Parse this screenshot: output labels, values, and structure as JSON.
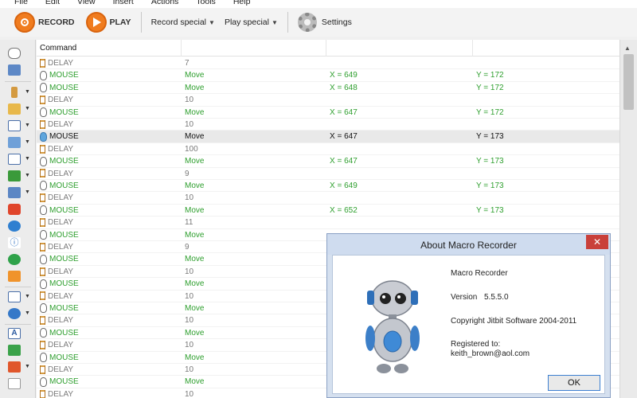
{
  "menubar": {
    "items": [
      "File",
      "Edit",
      "View",
      "Insert",
      "Actions",
      "Tools",
      "Help"
    ]
  },
  "toolbar": {
    "record_label": "RECORD",
    "play_label": "PLAY",
    "record_special_label": "Record special",
    "play_special_label": "Play special",
    "settings_label": "Settings"
  },
  "grid": {
    "columns": [
      "Command",
      "",
      "",
      ""
    ],
    "rows": [
      {
        "type": "delay",
        "cmd": "DELAY",
        "p1": "7",
        "p2": "",
        "p3": ""
      },
      {
        "type": "mouse",
        "cmd": "MOUSE",
        "p1": "Move",
        "p2": "X = 649",
        "p3": "Y = 172"
      },
      {
        "type": "mouse",
        "cmd": "MOUSE",
        "p1": "Move",
        "p2": "X = 648",
        "p3": "Y = 172"
      },
      {
        "type": "delay",
        "cmd": "DELAY",
        "p1": "10",
        "p2": "",
        "p3": ""
      },
      {
        "type": "mouse",
        "cmd": "MOUSE",
        "p1": "Move",
        "p2": "X = 647",
        "p3": "Y = 172"
      },
      {
        "type": "delay",
        "cmd": "DELAY",
        "p1": "10",
        "p2": "",
        "p3": ""
      },
      {
        "type": "mouse",
        "cmd": "MOUSE",
        "p1": "Move",
        "p2": "X = 647",
        "p3": "Y = 173",
        "selected": true
      },
      {
        "type": "delay",
        "cmd": "DELAY",
        "p1": "100",
        "p2": "",
        "p3": ""
      },
      {
        "type": "mouse",
        "cmd": "MOUSE",
        "p1": "Move",
        "p2": "X = 647",
        "p3": "Y = 173"
      },
      {
        "type": "delay",
        "cmd": "DELAY",
        "p1": "9",
        "p2": "",
        "p3": ""
      },
      {
        "type": "mouse",
        "cmd": "MOUSE",
        "p1": "Move",
        "p2": "X = 649",
        "p3": "Y = 173"
      },
      {
        "type": "delay",
        "cmd": "DELAY",
        "p1": "10",
        "p2": "",
        "p3": ""
      },
      {
        "type": "mouse",
        "cmd": "MOUSE",
        "p1": "Move",
        "p2": "X = 652",
        "p3": "Y = 173"
      },
      {
        "type": "delay",
        "cmd": "DELAY",
        "p1": "11",
        "p2": "",
        "p3": ""
      },
      {
        "type": "mouse",
        "cmd": "MOUSE",
        "p1": "Move",
        "p2": "",
        "p3": ""
      },
      {
        "type": "delay",
        "cmd": "DELAY",
        "p1": "9",
        "p2": "",
        "p3": ""
      },
      {
        "type": "mouse",
        "cmd": "MOUSE",
        "p1": "Move",
        "p2": "",
        "p3": ""
      },
      {
        "type": "delay",
        "cmd": "DELAY",
        "p1": "10",
        "p2": "",
        "p3": ""
      },
      {
        "type": "mouse",
        "cmd": "MOUSE",
        "p1": "Move",
        "p2": "",
        "p3": ""
      },
      {
        "type": "delay",
        "cmd": "DELAY",
        "p1": "10",
        "p2": "",
        "p3": ""
      },
      {
        "type": "mouse",
        "cmd": "MOUSE",
        "p1": "Move",
        "p2": "",
        "p3": ""
      },
      {
        "type": "delay",
        "cmd": "DELAY",
        "p1": "10",
        "p2": "",
        "p3": ""
      },
      {
        "type": "mouse",
        "cmd": "MOUSE",
        "p1": "Move",
        "p2": "",
        "p3": ""
      },
      {
        "type": "delay",
        "cmd": "DELAY",
        "p1": "10",
        "p2": "",
        "p3": ""
      },
      {
        "type": "mouse",
        "cmd": "MOUSE",
        "p1": "Move",
        "p2": "",
        "p3": ""
      },
      {
        "type": "delay",
        "cmd": "DELAY",
        "p1": "10",
        "p2": "",
        "p3": ""
      },
      {
        "type": "mouse",
        "cmd": "MOUSE",
        "p1": "Move",
        "p2": "",
        "p3": ""
      },
      {
        "type": "delay",
        "cmd": "DELAY",
        "p1": "10",
        "p2": "",
        "p3": ""
      }
    ]
  },
  "dialog": {
    "title": "About Macro Recorder",
    "close_glyph": "✕",
    "app_name": "Macro Recorder",
    "version_label": "Version",
    "version_value": "5.5.5.0",
    "copyright": "Copyright Jitbit Software 2004-2011",
    "registered_label": "Registered to:",
    "registered_email": "keith_brown@aol.com",
    "ok_label": "OK"
  },
  "colors": {
    "accent_orange": "#f07c1f",
    "mouse_text": "#2e9f2e",
    "delay_text": "#7a7a7a",
    "close_button": "#c9403a"
  }
}
